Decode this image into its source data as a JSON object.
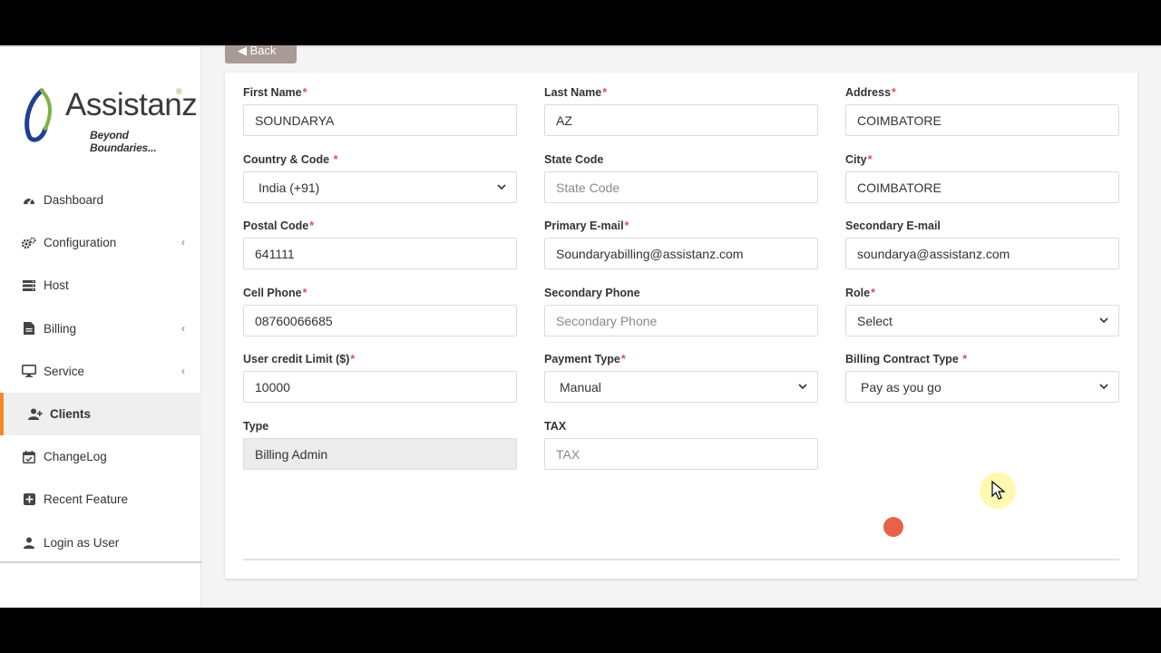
{
  "brand": {
    "name": "Assistanz",
    "tagline": "Beyond Boundaries...",
    "registered": "®"
  },
  "back_label": "Back",
  "sidebar": {
    "items": [
      {
        "label": "Dashboard",
        "icon": "dashboard-icon",
        "has_submenu": false
      },
      {
        "label": "Configuration",
        "icon": "gears-icon",
        "has_submenu": true
      },
      {
        "label": "Host",
        "icon": "server-icon",
        "has_submenu": false
      },
      {
        "label": "Billing",
        "icon": "file-icon",
        "has_submenu": true
      },
      {
        "label": "Service",
        "icon": "monitor-icon",
        "has_submenu": true
      },
      {
        "label": "Clients",
        "icon": "user-plus-icon",
        "has_submenu": false,
        "active": true
      },
      {
        "label": "ChangeLog",
        "icon": "calendar-check-icon",
        "has_submenu": false
      },
      {
        "label": "Recent Feature",
        "icon": "plus-square-icon",
        "has_submenu": false
      },
      {
        "label": "Login as User",
        "icon": "user-icon",
        "has_submenu": false
      }
    ]
  },
  "form": {
    "first_name": {
      "label": "First Name",
      "required": "*",
      "value": "SOUNDARYA"
    },
    "last_name": {
      "label": "Last Name",
      "required": "*",
      "value": "AZ"
    },
    "address": {
      "label": "Address",
      "required": "*",
      "value": "COIMBATORE"
    },
    "country": {
      "label": "Country & Code",
      "required": " *",
      "value": "India (+91)"
    },
    "state_code": {
      "label": "State Code",
      "placeholder": "State Code"
    },
    "city": {
      "label": "City",
      "required": "*",
      "value": "COIMBATORE"
    },
    "postal_code": {
      "label": "Postal Code",
      "required": "*",
      "value": "641111"
    },
    "primary_email": {
      "label": "Primary E-mail",
      "required": "*",
      "value": "Soundaryabilling@assistanz.com"
    },
    "secondary_email": {
      "label": "Secondary E-mail",
      "value": "soundarya@assistanz.com"
    },
    "cell_phone": {
      "label": "Cell Phone",
      "required": "*",
      "value": "08760066685"
    },
    "secondary_phone": {
      "label": "Secondary Phone",
      "placeholder": "Secondary Phone"
    },
    "role": {
      "label": "Role",
      "required": "*",
      "value": "Select"
    },
    "credit_limit": {
      "label": "User credit Limit ($)",
      "required": "*",
      "value": "10000"
    },
    "payment_type": {
      "label": "Payment Type",
      "required": "*",
      "value": "Manual"
    },
    "contract_type": {
      "label": "Billing Contract Type",
      "required": " *",
      "value": "Pay as you go"
    },
    "type": {
      "label": "Type",
      "value": "Billing Admin"
    },
    "tax": {
      "label": "TAX",
      "placeholder": "TAX"
    }
  },
  "colors": {
    "accent": "#f08a24",
    "required": "#d9534f",
    "back_button": "#a89a94",
    "logo_blue": "#1f3f8f",
    "logo_green": "#7bb342"
  }
}
